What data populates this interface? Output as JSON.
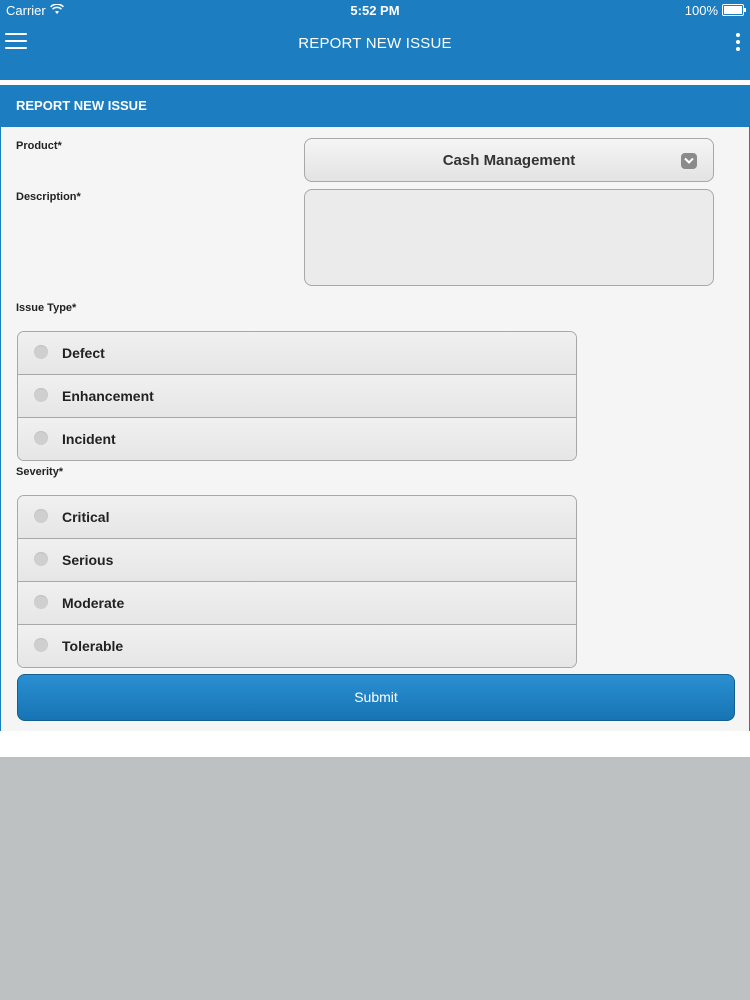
{
  "status_bar": {
    "carrier": "Carrier",
    "time": "5:52 PM",
    "battery": "100%"
  },
  "nav": {
    "title": "REPORT NEW ISSUE"
  },
  "panel": {
    "header": "REPORT NEW ISSUE"
  },
  "form": {
    "product_label": "Product*",
    "product_value": "Cash Management",
    "description_label": "Description*",
    "description_value": "",
    "issue_type_label": "Issue Type*",
    "issue_types": [
      "Defect",
      "Enhancement",
      "Incident"
    ],
    "severity_label": "Severity*",
    "severities": [
      "Critical",
      "Serious",
      "Moderate",
      "Tolerable"
    ],
    "submit_label": "Submit"
  },
  "colors": {
    "primary": "#1c7ec1",
    "background": "#bec1c2"
  },
  "icons": {
    "menu": "hamburger-menu-icon",
    "more": "more-vertical-icon",
    "dropdown": "chevron-down-icon",
    "wifi": "wifi-icon",
    "battery": "battery-icon"
  }
}
